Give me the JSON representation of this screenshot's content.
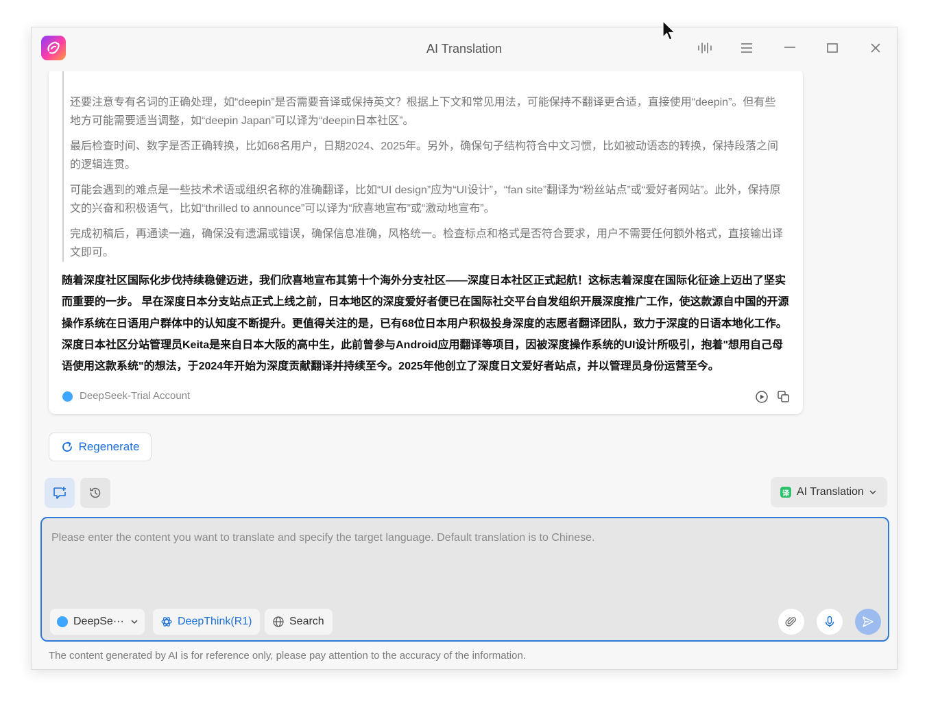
{
  "window": {
    "title": "AI Translation"
  },
  "thinking": {
    "paragraphs": [
      "还要注意专有名词的正确处理，如“deepin”是否需要音译或保持英文？根据上下文和常见用法，可能保持不翻译更合适，直接使用“deepin”。但有些地方可能需要适当调整，如“deepin Japan”可以译为“deepin日本社区”。",
      "最后检查时间、数字是否正确转换，比如68名用户，日期2024、2025年。另外，确保句子结构符合中文习惯，比如被动语态的转换，保持段落之间的逻辑连贯。",
      "可能会遇到的难点是一些技术术语或组织名称的准确翻译，比如“UI design”应为“UI设计”，“fan site”翻译为“粉丝站点”或“爱好者网站”。此外，保持原文的兴奋和积极语气，比如“thrilled to announce”可以译为“欣喜地宣布”或“激动地宣布”。",
      "完成初稿后，再通读一遍，确保没有遗漏或错误，确保信息准确，风格统一。检查标点和格式是否符合要求，用户不需要任何额外格式，直接输出译文即可。"
    ]
  },
  "answer": {
    "text": "随着深度社区国际化步伐持续稳健迈进，我们欣喜地宣布其第十个海外分支社区——深度日本社区正式起航！这标志着深度在国际化征途上迈出了坚实而重要的一步。 早在深度日本分支站点正式上线之前，日本地区的深度爱好者便已在国际社交平台自发组织开展深度推广工作，使这款源自中国的开源操作系统在日语用户群体中的认知度不断提升。更值得关注的是，已有68位日本用户积极投身深度的志愿者翻译团队，致力于深度的日语本地化工作。 深度日本社区分站管理员Keita是来自日本大阪的高中生，此前曾参与Android应用翻译等项目，因被深度操作系统的UI设计所吸引，抱着\"想用自己母语使用这款系统\"的想法，于2024年开始为深度贡献翻译并持续至今。2025年他创立了深度日文爱好者站点，并以管理员身份运营至今。"
  },
  "card": {
    "account": "DeepSeek-Trial Account"
  },
  "actions": {
    "regenerate": "Regenerate"
  },
  "assistant": {
    "selected": "AI Translation"
  },
  "input": {
    "placeholder": "Please enter the content you want to translate and specify the target language. Default translation is to Chinese.",
    "model": "DeepSe···",
    "deepthink": "DeepThink(R1)",
    "search": "Search"
  },
  "footer": {
    "disclaimer": "The content generated by AI is for reference only, please pay attention to the accuracy of the information."
  },
  "colors": {
    "accent": "#1a6fd9",
    "input_border": "#2f7ad8",
    "send_button": "#9cbcf0",
    "model_dot": "#3ea6ff",
    "translation_icon": "#2ec06b"
  }
}
